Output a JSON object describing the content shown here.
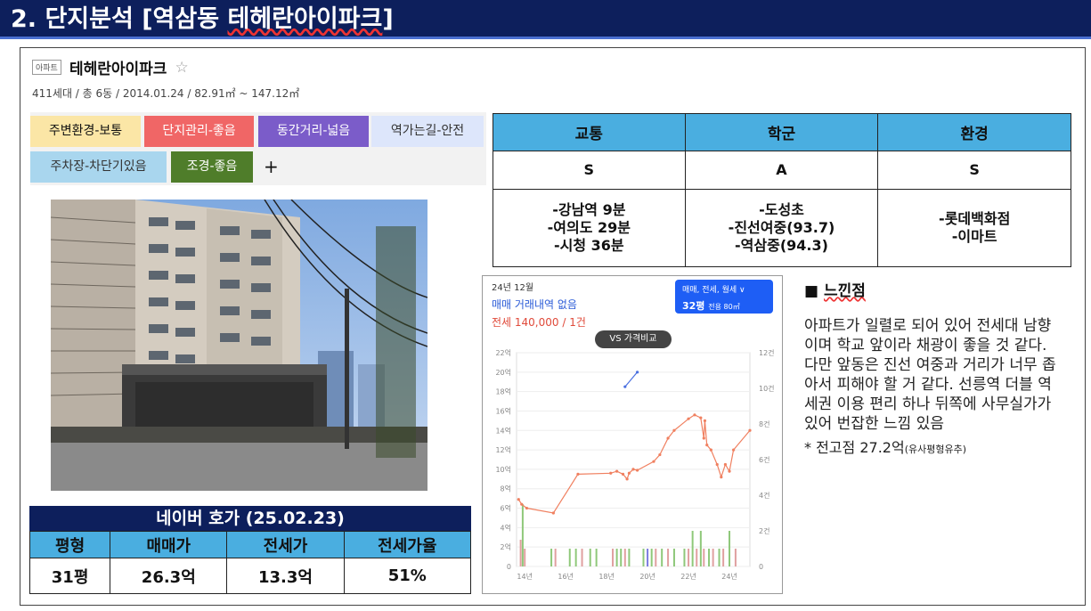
{
  "title": {
    "prefix": "2. 단지분석 [역삼동 ",
    "name": "테헤란아이파크",
    "suffix": "]"
  },
  "apt": {
    "tag": "아파트",
    "name": "테헤란아이파크",
    "star": "☆",
    "sub": "411세대 / 총 6동 / 2014.01.24 / 82.91㎡ ~ 147.12㎡"
  },
  "tags": [
    {
      "label": "주변환경-보통",
      "bg": "#fbe6a6"
    },
    {
      "label": "단지관리-좋음",
      "bg": "#f06666"
    },
    {
      "label": "동간거리-넓음",
      "bg": "#7b5cc9"
    },
    {
      "label": "역가는길-안전",
      "bg": "#dde6fb"
    },
    {
      "label": "주차장-차단기있음",
      "bg": "#a9d6ee"
    },
    {
      "label": "조경-좋음",
      "bg": "#4f7d2a"
    },
    {
      "label": "+",
      "bg": "#f2f2f2"
    }
  ],
  "hoga": {
    "title": "네이버 호가 (25.02.23)",
    "headers": [
      "평형",
      "매매가",
      "전세가",
      "전세가율"
    ],
    "row": [
      "31평",
      "26.3억",
      "13.3억",
      "51%"
    ]
  },
  "grade": {
    "headers": [
      "교통",
      "학군",
      "환경"
    ],
    "grades": [
      "S",
      "A",
      "S"
    ],
    "details": [
      [
        "-강남역 9분",
        "-여의도 29분",
        "-시청 36분"
      ],
      [
        "-도성초",
        "-진선여중(93.7)",
        "-역삼중(94.3)"
      ],
      [
        "-롯데백화점",
        "-이마트"
      ]
    ]
  },
  "chart_panel": {
    "month": "24년 12월",
    "no_trade": "매매 거래내역 없음",
    "jeonse": "전세 140,000 / 1건",
    "filter": "매매, 전세, 월세",
    "size": "32평",
    "size_sub": "전용 80㎡",
    "compare": "VS 가격비교"
  },
  "chart_data": {
    "type": "line",
    "x_ticks": [
      "14년",
      "16년",
      "18년",
      "20년",
      "22년",
      "24년"
    ],
    "y_ticks": [
      "0",
      "2억",
      "4억",
      "6억",
      "8억",
      "10억",
      "12억",
      "14억",
      "16억",
      "18억",
      "20억",
      "22억"
    ],
    "y2_ticks": [
      "0",
      "2건",
      "4건",
      "6건",
      "8건",
      "10건",
      "12건"
    ],
    "ylim": [
      0,
      22
    ],
    "y2lim": [
      0,
      12
    ],
    "xlim": [
      2013.6,
      2025.0
    ],
    "series": [
      {
        "color": "#f08060",
        "points": [
          [
            2013.7,
            6.9
          ],
          [
            2013.85,
            6.4
          ],
          [
            2014.1,
            6.0
          ],
          [
            2015.4,
            5.5
          ],
          [
            2016.6,
            9.5
          ],
          [
            2018.2,
            9.6
          ],
          [
            2018.5,
            9.8
          ],
          [
            2018.8,
            9.5
          ],
          [
            2019.0,
            9.0
          ],
          [
            2019.1,
            9.6
          ],
          [
            2019.3,
            10.0
          ],
          [
            2019.5,
            9.9
          ],
          [
            2020.3,
            10.8
          ],
          [
            2020.6,
            11.5
          ],
          [
            2021.0,
            13.2
          ],
          [
            2021.3,
            14.0
          ],
          [
            2022.0,
            15.2
          ],
          [
            2022.3,
            15.6
          ],
          [
            2022.6,
            15.3
          ],
          [
            2022.75,
            13.2
          ],
          [
            2022.8,
            15.0
          ],
          [
            2022.9,
            12.5
          ],
          [
            2023.1,
            12.0
          ],
          [
            2023.4,
            10.5
          ],
          [
            2023.6,
            9.2
          ],
          [
            2023.8,
            10.5
          ],
          [
            2024.0,
            9.8
          ],
          [
            2024.2,
            12.0
          ],
          [
            2025.0,
            14.0
          ]
        ]
      },
      {
        "color": "#4a70e0",
        "points": [
          [
            2018.9,
            18.5
          ],
          [
            2019.5,
            20.0
          ]
        ]
      }
    ],
    "bars": [
      {
        "x": 2013.8,
        "v": 1.5,
        "c": "#e0a0a0"
      },
      {
        "x": 2013.9,
        "v": 3.5,
        "c": "#8fc87a"
      },
      {
        "x": 2014.0,
        "v": 1.0,
        "c": "#e0a0a0"
      },
      {
        "x": 2015.3,
        "v": 1.0,
        "c": "#8fc87a"
      },
      {
        "x": 2015.5,
        "v": 1.0,
        "c": "#e0a0a0"
      },
      {
        "x": 2016.2,
        "v": 1.0,
        "c": "#8fc87a"
      },
      {
        "x": 2016.5,
        "v": 1.0,
        "c": "#8fc87a"
      },
      {
        "x": 2016.8,
        "v": 1.0,
        "c": "#e0a0a0"
      },
      {
        "x": 2017.2,
        "v": 1.0,
        "c": "#8fc87a"
      },
      {
        "x": 2017.5,
        "v": 1.0,
        "c": "#8fc87a"
      },
      {
        "x": 2018.3,
        "v": 1.0,
        "c": "#e0a0a0"
      },
      {
        "x": 2018.5,
        "v": 1.0,
        "c": "#8fc87a"
      },
      {
        "x": 2018.7,
        "v": 1.0,
        "c": "#8fc87a"
      },
      {
        "x": 2018.9,
        "v": 1.0,
        "c": "#e0a0a0"
      },
      {
        "x": 2019.1,
        "v": 1.0,
        "c": "#8fc87a"
      },
      {
        "x": 2019.8,
        "v": 1.0,
        "c": "#8fc87a"
      },
      {
        "x": 2020.0,
        "v": 1.0,
        "c": "#7a7ae0"
      },
      {
        "x": 2020.2,
        "v": 1.0,
        "c": "#8fc87a"
      },
      {
        "x": 2020.4,
        "v": 1.0,
        "c": "#e0a0a0"
      },
      {
        "x": 2020.7,
        "v": 1.0,
        "c": "#8fc87a"
      },
      {
        "x": 2021.0,
        "v": 1.0,
        "c": "#e0a0a0"
      },
      {
        "x": 2021.3,
        "v": 1.0,
        "c": "#8fc87a"
      },
      {
        "x": 2021.8,
        "v": 1.0,
        "c": "#8fc87a"
      },
      {
        "x": 2022.0,
        "v": 1.0,
        "c": "#e0a0a0"
      },
      {
        "x": 2022.2,
        "v": 2.0,
        "c": "#8fc87a"
      },
      {
        "x": 2022.4,
        "v": 1.0,
        "c": "#e0a0a0"
      },
      {
        "x": 2022.6,
        "v": 2.0,
        "c": "#8fc87a"
      },
      {
        "x": 2022.75,
        "v": 1.0,
        "c": "#e0a0a0"
      },
      {
        "x": 2023.0,
        "v": 1.0,
        "c": "#8fc87a"
      },
      {
        "x": 2023.2,
        "v": 1.0,
        "c": "#e0a0a0"
      },
      {
        "x": 2023.5,
        "v": 1.0,
        "c": "#8fc87a"
      },
      {
        "x": 2023.7,
        "v": 1.0,
        "c": "#e0a0a0"
      },
      {
        "x": 2024.0,
        "v": 2.0,
        "c": "#8fc87a"
      },
      {
        "x": 2024.3,
        "v": 1.0,
        "c": "#e0a0a0"
      }
    ]
  },
  "feel": {
    "heading": "■ ",
    "heading_word": "느낀점",
    "body": "아파트가 일렬로 되어 있어 전세대 남향이며 학교 앞이라 채광이 좋을 것 같다. 다만 앞동은 진선 여중과 거리가 너무 좁아서 피해야 할 거 같다. 선릉역 더블 역세권 이용 편리 하나 뒤쪽에 사무실가가 있어 번잡한 느낌 있음",
    "note": "* 전고점 27.2억",
    "note_small": "(유사평형유추)"
  }
}
